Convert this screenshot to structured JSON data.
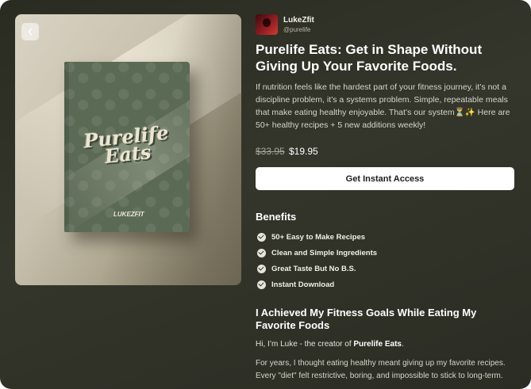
{
  "creator": {
    "name": "LukeZfit",
    "handle": "@purelife"
  },
  "product": {
    "title": "Purelife Eats: Get in Shape Without Giving Up Your Favorite Foods.",
    "description": "If nutrition feels like the hardest part of your fitness journey, it’s not a discipline problem, it’s a systems problem. Simple, repeatable meals that make eating healthy enjoyable. That’s our system⏳✨ Here are 50+ healthy recipes + 5 new additions weekly!",
    "old_price": "$33.95",
    "price": "$19.95",
    "cta_label": "Get Instant Access",
    "cover_title": "Purelife Eats",
    "cover_brand": "LUKEZFIT"
  },
  "benefits": {
    "heading": "Benefits",
    "items": [
      "50+ Easy to Make Recipes",
      "Clean and Simple Ingredients",
      "Great Taste But No B.S.",
      "Instant Download"
    ]
  },
  "story": {
    "heading": "I Achieved My Fitness Goals While Eating My Favorite Foods",
    "intro_prefix": "Hi, I’m Luke - the creator of ",
    "intro_product": "Purelife Eats",
    "intro_suffix": ".",
    "body": "For years, I thought eating healthy meant giving up my favorite recipes. Every \"diet\" felt restrictive, boring, and impossible to stick to long-term."
  },
  "icons": {
    "back": "chevron-left-icon",
    "check": "check-circle-icon"
  }
}
